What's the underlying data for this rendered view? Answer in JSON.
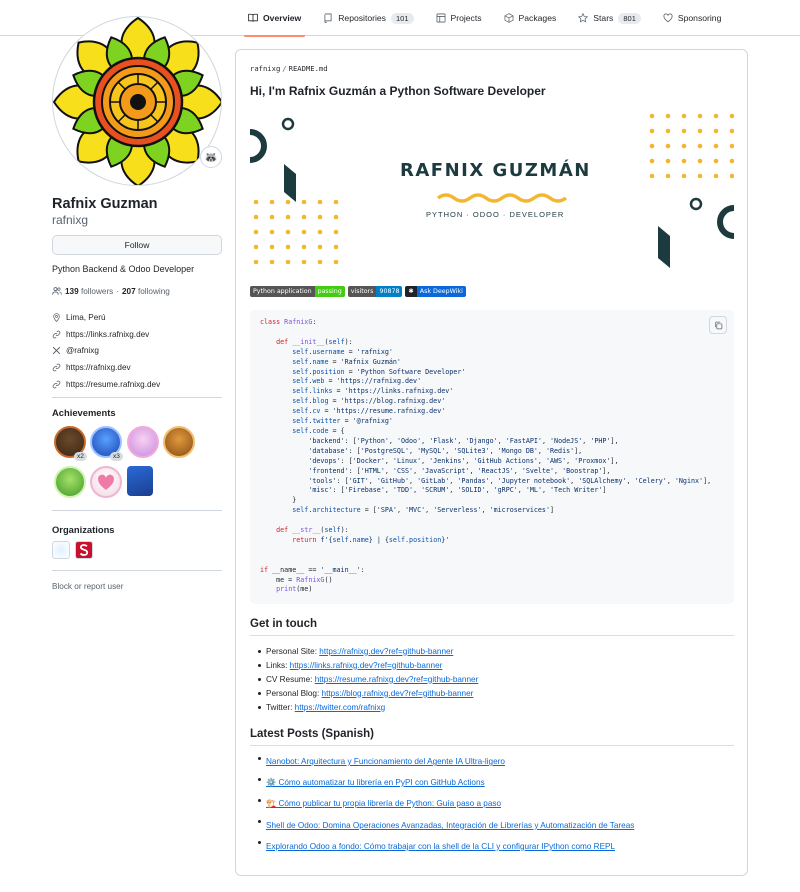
{
  "nav": {
    "overview": "Overview",
    "repositories": "Repositories",
    "repositories_count": "101",
    "projects": "Projects",
    "packages": "Packages",
    "stars": "Stars",
    "stars_count": "801",
    "sponsoring": "Sponsoring"
  },
  "profile": {
    "fullname": "Rafnix Guzman",
    "username": "rafnixg",
    "status_emoji": "🦝",
    "follow_label": "Follow",
    "bio": "Python Backend & Odoo Developer",
    "followers_count": "139",
    "followers_label": "followers",
    "following_count": "207",
    "following_label": "following",
    "location": "Lima, Perú",
    "links": [
      "https://links.rafnixg.dev",
      "@rafnixg",
      "https://rafnixg.dev",
      "https://resume.rafnixg.dev"
    ]
  },
  "achievements": {
    "title": "Achievements",
    "items": [
      {
        "name": "pull-shark",
        "count": "x2"
      },
      {
        "name": "starstruck",
        "count": "x3"
      },
      {
        "name": "yolo",
        "count": ""
      },
      {
        "name": "quickdraw",
        "count": ""
      },
      {
        "name": "pair-extraordinaire",
        "count": ""
      },
      {
        "name": "heart-on-sleeve",
        "count": ""
      },
      {
        "name": "arctic-code-vault",
        "count": ""
      }
    ]
  },
  "organizations": {
    "title": "Organizations",
    "block_label": "Block or report user"
  },
  "readme": {
    "crumb_user": "rafnixg",
    "crumb_file": "README.md",
    "title": "Hi, I'm Rafnix Guzmán a Python Software Developer",
    "banner_name": "RAFNIX GUZMÁN",
    "banner_sub": "PYTHON · ODOO · DEVELOPER",
    "shields": [
      {
        "label": "Python application",
        "value": "passing",
        "color": "#4c1"
      },
      {
        "label": "visitors",
        "value": "90878",
        "color": "#007ec6"
      },
      {
        "label": "",
        "value": "Ask DeepWiki",
        "color": "#0969da"
      }
    ],
    "get_in_touch": "Get in touch",
    "contacts": [
      {
        "label": "Personal Site:",
        "url": "https://rafnixg.dev?ref=github-banner"
      },
      {
        "label": "Links:",
        "url": "https://links.rafnixg.dev?ref=github-banner"
      },
      {
        "label": "CV Resume:",
        "url": "https://resume.rafnixg.dev?ref=github-banner"
      },
      {
        "label": "Personal Blog:",
        "url": "https://blog.rafnixg.dev?ref=github-banner"
      },
      {
        "label": "Twitter:",
        "url": "https://twitter.com/rafnixg"
      }
    ],
    "latest_posts": "Latest Posts (Spanish)",
    "posts": [
      "Nanobot: Arquitectura y Funcionamiento del Agente IA Ultra-ligero",
      "⚙️ Cómo automatizar tu librería en PyPI con GitHub Actions",
      "🏗️ Cómo publicar tu propia librería de Python: Guía paso a paso",
      "Shell de Odoo: Domina Operaciones Avanzadas, Integración de Librerías y Automatización de Tareas",
      "Explorando Odoo a fondo: Cómo trabajar con la shell de la CLI y configurar IPython como REPL"
    ]
  },
  "colors": {
    "accent": "#fd8c73",
    "link": "#0969da",
    "banner_dark": "#1d3a3f",
    "banner_gold": "#f2b631"
  }
}
